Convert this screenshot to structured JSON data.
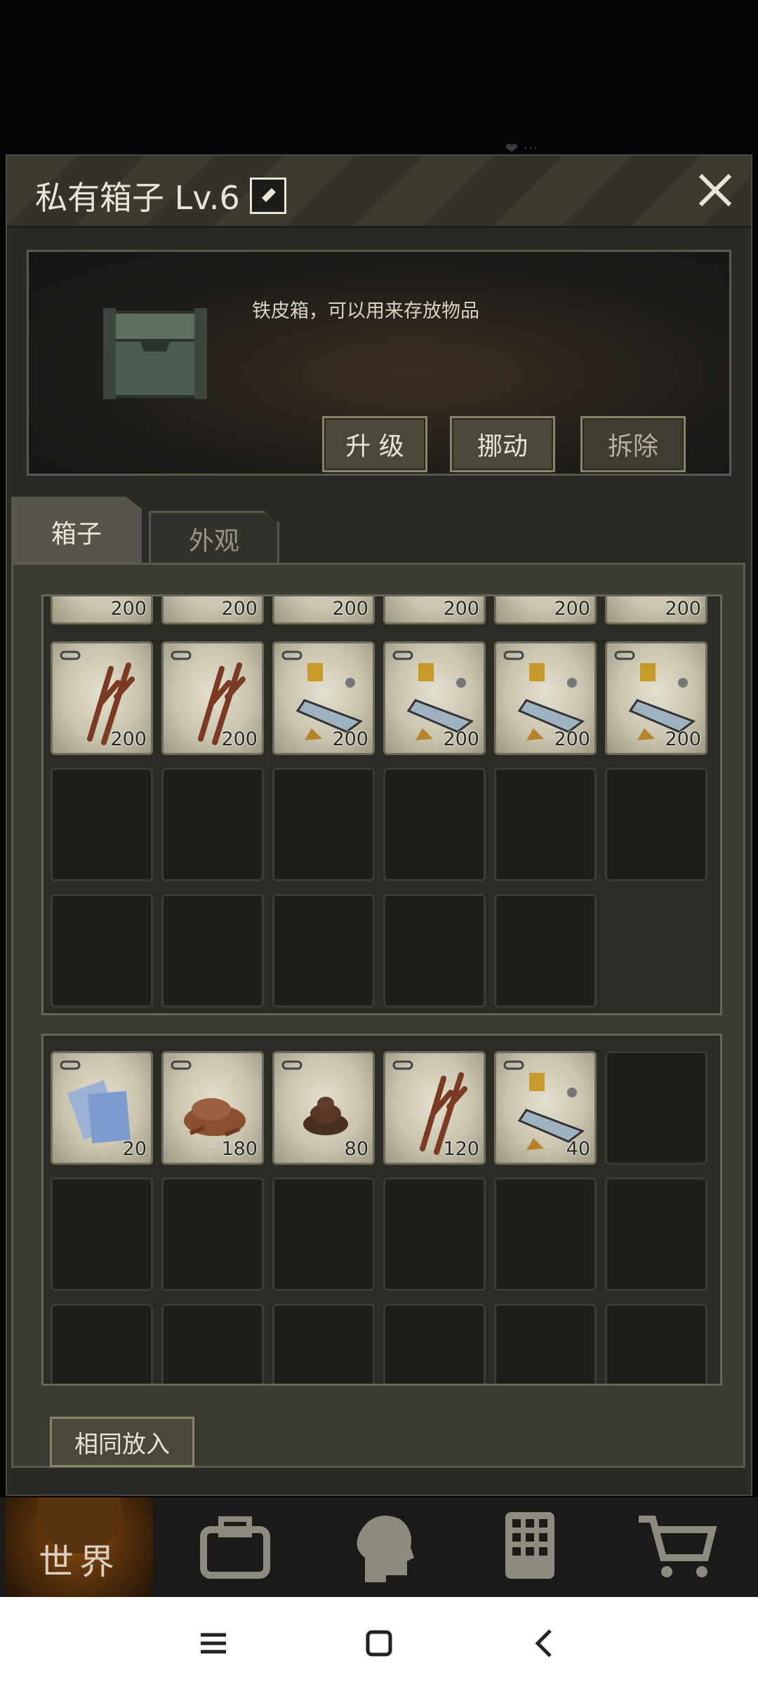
{
  "window": {
    "title": "私有箱子 Lv.6",
    "close_label": "×"
  },
  "info": {
    "description": "铁皮箱，可以用来存放物品",
    "buttons": {
      "upgrade": "升 级",
      "move": "挪动",
      "dismantle": "拆除"
    }
  },
  "tabs": [
    {
      "label": "箱子",
      "active": true
    },
    {
      "label": "外观",
      "active": false
    }
  ],
  "box_grid": {
    "partial_row_counts": [
      "200",
      "200",
      "200",
      "200",
      "200",
      "200"
    ],
    "row1": [
      {
        "item": "branch",
        "count": "200"
      },
      {
        "item": "branch",
        "count": "200"
      },
      {
        "item": "scrap-metal",
        "count": "200"
      },
      {
        "item": "scrap-metal",
        "count": "200"
      },
      {
        "item": "scrap-metal",
        "count": "200"
      },
      {
        "item": "scrap-metal",
        "count": "200"
      }
    ]
  },
  "backpack_grid": {
    "row1": [
      {
        "item": "paper",
        "count": "20"
      },
      {
        "item": "wood-chips",
        "count": "180"
      },
      {
        "item": "dung",
        "count": "80"
      },
      {
        "item": "branch",
        "count": "120"
      },
      {
        "item": "scrap-metal",
        "count": "40"
      }
    ]
  },
  "same_put_button": "相同放入",
  "bottom_nav": {
    "world_label": "世界"
  },
  "colors": {
    "panel_bg": "#2a2925",
    "slot_filled": "#d6d1bc",
    "button_bg": "#4b4839",
    "world_tab": "#8a4a0e"
  }
}
